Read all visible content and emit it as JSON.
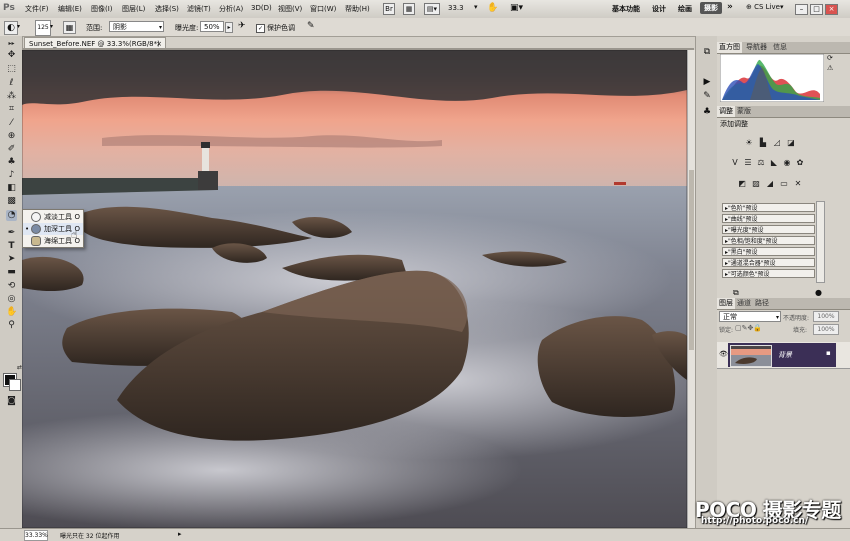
{
  "app": {
    "logo": "Ps",
    "menu": [
      "文件(F)",
      "编辑(E)",
      "图像(I)",
      "图层(L)",
      "选择(S)",
      "滤镜(T)",
      "分析(A)",
      "3D(D)",
      "视图(V)",
      "窗口(W)",
      "帮助(H)"
    ],
    "zoom_field": "33.3",
    "workspaces": [
      "基本功能",
      "设计",
      "绘画",
      "摄影"
    ],
    "workspace_more": "»",
    "cslive": "CS Live"
  },
  "options": {
    "brush_size": "125",
    "range_label": "范围:",
    "range_value": "阴影",
    "exposure_label": "曝光度:",
    "exposure_value": "50%",
    "protect_tone_label": "保护色调",
    "protect_tone_checked": true
  },
  "document": {
    "tab_title": "Sunset_Before.NEF @ 33.3%(RGB/8*)",
    "tab_close": "×"
  },
  "tool_flyout": {
    "items": [
      {
        "label": "减淡工具",
        "shortcut": "O",
        "active": false
      },
      {
        "label": "加深工具",
        "shortcut": "O",
        "active": true
      },
      {
        "label": "海绵工具",
        "shortcut": "O",
        "active": false
      }
    ]
  },
  "panels": {
    "histogram_tabs": [
      "直方图",
      "导航器",
      "信息"
    ],
    "adjust_tabs": [
      "调整",
      "蒙版"
    ],
    "adjust_title": "添加调整",
    "presets": [
      "\"色阶\"预设",
      "\"曲线\"预设",
      "\"曝光度\"预设",
      "\"色相/饱和度\"预设",
      "\"黑白\"预设",
      "\"通道混合器\"预设",
      "\"可选颜色\"预设"
    ],
    "layers_tabs": [
      "图层",
      "通道",
      "路径"
    ],
    "blend_mode": "正常",
    "opacity_label": "不透明度:",
    "opacity_value": "100%",
    "lock_label": "锁定:",
    "fill_label": "填充:",
    "fill_value": "100%",
    "layer_name": "背景"
  },
  "status": {
    "zoom": "33.33%",
    "info": "曝光只在 32 位起作用"
  },
  "watermark": {
    "brand": "POCO 摄影专题",
    "url": "http://photo.poco.cn/"
  },
  "colors": {
    "foreground": "#111111",
    "background": "#ffffff",
    "layer_selected": "#3b2f56",
    "workspace_active": "#555555"
  }
}
